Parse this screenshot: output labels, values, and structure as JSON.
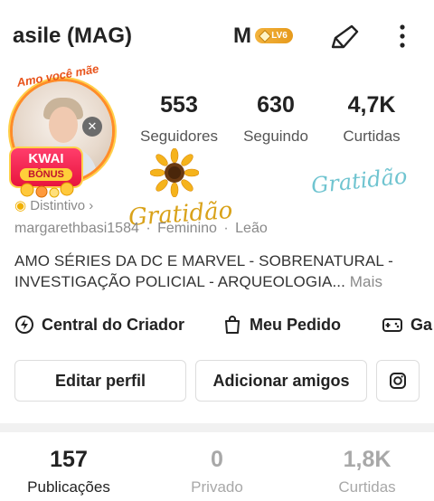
{
  "header": {
    "name": "asile (MAG)",
    "m": "M",
    "level_badge": "LV6",
    "share_icon": "share-icon",
    "more_icon": "more-vertical-icon"
  },
  "avatar": {
    "arc_text": "Amo você mãe",
    "badge_line1": "KWAI",
    "badge_line2": "BÔNUS",
    "close_icon": "close-icon"
  },
  "stats": [
    {
      "value": "553",
      "label": "Seguidores"
    },
    {
      "value": "630",
      "label": "Seguindo"
    },
    {
      "value": "4,7K",
      "label": "Curtidas"
    }
  ],
  "stickers": {
    "gratidao_gold": "Gratidão",
    "gratidao_teal": "Gratidão"
  },
  "meta": {
    "distintivo": "Distintivo ›",
    "username": "margarethbasi1584",
    "gender": "Feminino",
    "sign": "Leão",
    "separator": "·"
  },
  "bio": {
    "text": "AMO SÉRIES DA DC E MARVEL - SOBRENATURAL - INVESTIGAÇÃO POLICIAL - ARQUEOLOGIA...",
    "more": "Mais"
  },
  "quick_links": [
    {
      "label": "Central do Criador",
      "icon": "lightning-icon"
    },
    {
      "label": "Meu Pedido",
      "icon": "shopping-bag-icon"
    },
    {
      "label": "Ga",
      "icon": "gamepad-icon"
    }
  ],
  "buttons": {
    "edit": "Editar perfil",
    "add_friends": "Adicionar amigos",
    "instagram_icon": "instagram-icon"
  },
  "tabs": [
    {
      "value": "157",
      "label": "Publicações",
      "active": true
    },
    {
      "value": "0",
      "label": "Privado",
      "active": false
    },
    {
      "value": "1,8K",
      "label": "Curtidas",
      "active": false
    }
  ],
  "colors": {
    "accent_orange": "#ff8c2a",
    "kwai_red": "#e8153d",
    "level_gold": "#e69a1c",
    "muted_text": "#8a8a8a",
    "inactive_tab": "#a8a8a8"
  }
}
